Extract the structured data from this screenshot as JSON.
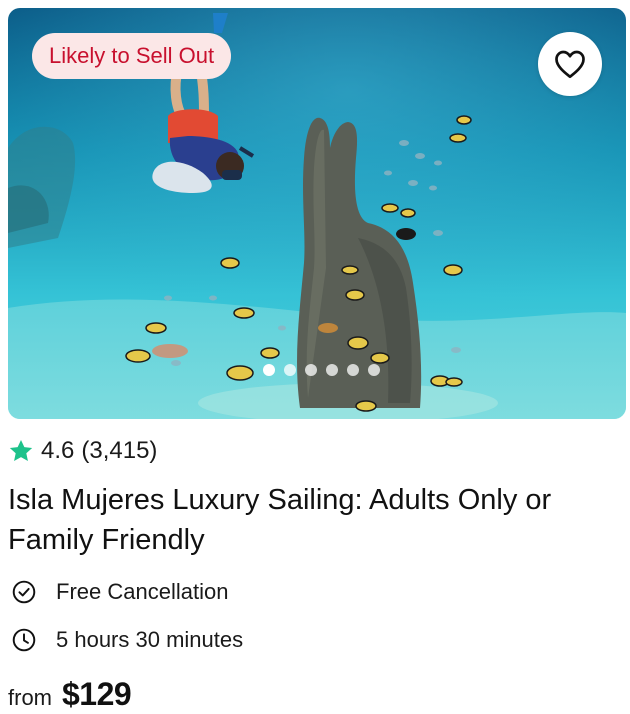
{
  "badge": {
    "label": "Likely to Sell Out"
  },
  "carousel": {
    "total": 6,
    "active_index": 0
  },
  "rating": {
    "score": "4.6",
    "count": "(3,415)"
  },
  "title": "Isla Mujeres Luxury Sailing: Adults Only or Family Friendly",
  "features": [
    {
      "icon": "check-circle-icon",
      "label": "Free Cancellation"
    },
    {
      "icon": "clock-icon",
      "label": "5 hours 30 minutes"
    }
  ],
  "price": {
    "prefix": "from",
    "amount": "$129"
  },
  "colors": {
    "star": "#1ec28b",
    "badge_text": "#c8102e",
    "badge_bg": "#fbe7e7",
    "water": "#2fc4d8"
  }
}
